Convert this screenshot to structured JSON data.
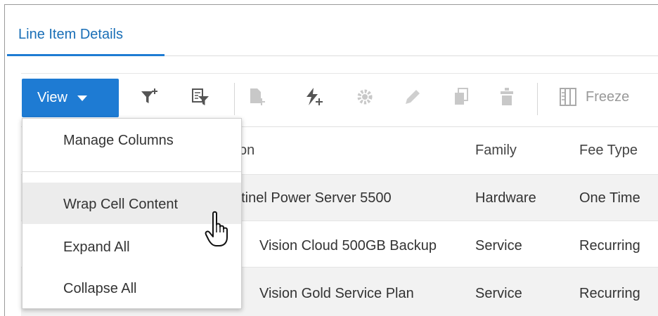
{
  "tabs": [
    {
      "label": "Line Item Details",
      "active": true
    }
  ],
  "toolbar": {
    "view_label": "View",
    "icons": [
      "add-filter-icon",
      "filter-table-icon",
      "add-row-icon",
      "add-bolt-icon",
      "settings-gear-icon",
      "edit-pencil-icon",
      "copy-icon",
      "delete-trash-icon",
      "freeze-columns-icon"
    ],
    "freeze_label": "Freeze"
  },
  "table": {
    "columns": [
      "on",
      "Family",
      "Fee Type"
    ],
    "rows": [
      {
        "description": "ntinel Power Server 5500",
        "family": "Hardware",
        "fee_type": "One Time"
      },
      {
        "description": "Vision Cloud 500GB Backup",
        "family": "Service",
        "fee_type": "Recurring"
      },
      {
        "description": "Vision Gold Service Plan",
        "family": "Service",
        "fee_type": "Recurring"
      }
    ]
  },
  "view_menu": {
    "items": [
      "Manage Columns",
      "Wrap Cell Content",
      "Expand All",
      "Collapse All"
    ],
    "hovered": "Wrap Cell Content"
  },
  "colors": {
    "accent": "#1e7bd3",
    "hover": "#ececec"
  }
}
